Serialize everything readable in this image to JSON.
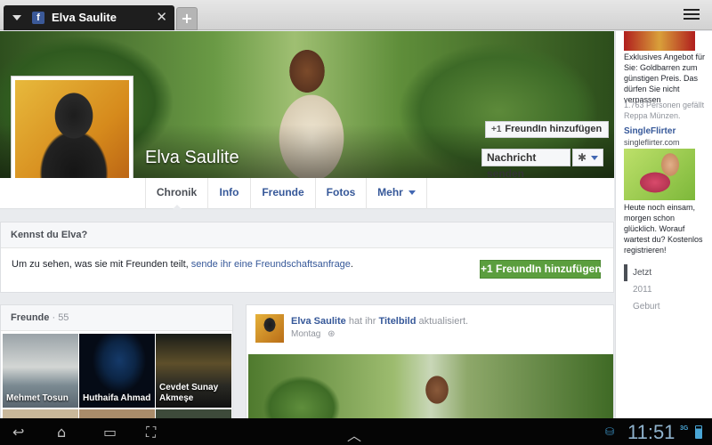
{
  "browser": {
    "tab_title": "Elva Saulite",
    "tab_favicon": "f",
    "tab_close": "✕",
    "new_tab": "+"
  },
  "profile": {
    "name": "Elva Saulite",
    "add_friend_label": "FreundIn hinzufügen",
    "message_label": "Nachricht senden",
    "settings_icon": "gear-icon"
  },
  "nav": {
    "tabs": [
      "Chronik",
      "Info",
      "Freunde",
      "Fotos",
      "Mehr"
    ]
  },
  "know_box": {
    "title": "Kennst du Elva?",
    "text": "Um zu sehen, was sie mit Freunden teilt, ",
    "link": "sende ihr eine Freundschaftsanfrage",
    "suffix": ".",
    "button": "FreundIn hinzufügen"
  },
  "friends_box": {
    "title": "Freunde",
    "count": "· 55",
    "friends": [
      {
        "name": "Mehmet Tosun"
      },
      {
        "name": "Huthaifa Ahmad"
      },
      {
        "name": "Cevdet Sunay Akmeşe"
      }
    ]
  },
  "post": {
    "author": "Elva Saulite",
    "action_pre": " hat ihr ",
    "action_link": "Titelbild",
    "action_post": " aktualisiert.",
    "time": "Montag",
    "audience_icon": "globe-icon"
  },
  "ads": [
    {
      "text": "Exklusives Angebot für Sie: Goldbarren zum günstigen Preis. Das dürfen Sie nicht verpassen",
      "likes": "1.763 Personen gefällt Reppa Münzen."
    },
    {
      "title": "SingleFlirter",
      "domain": "singleflirter.com",
      "text": "Heute noch einsam, morgen schon glücklich. Worauf wartest du? Kostenlos registrieren!"
    }
  ],
  "timeline": [
    "Jetzt",
    "2011",
    "Geburt"
  ],
  "system": {
    "clock": "11:51",
    "signal": "3G"
  },
  "colors": {
    "facebook_blue": "#3b5998",
    "link": "#365899",
    "green_button": "#5b9e3e",
    "page_bg": "#e9ebee"
  }
}
